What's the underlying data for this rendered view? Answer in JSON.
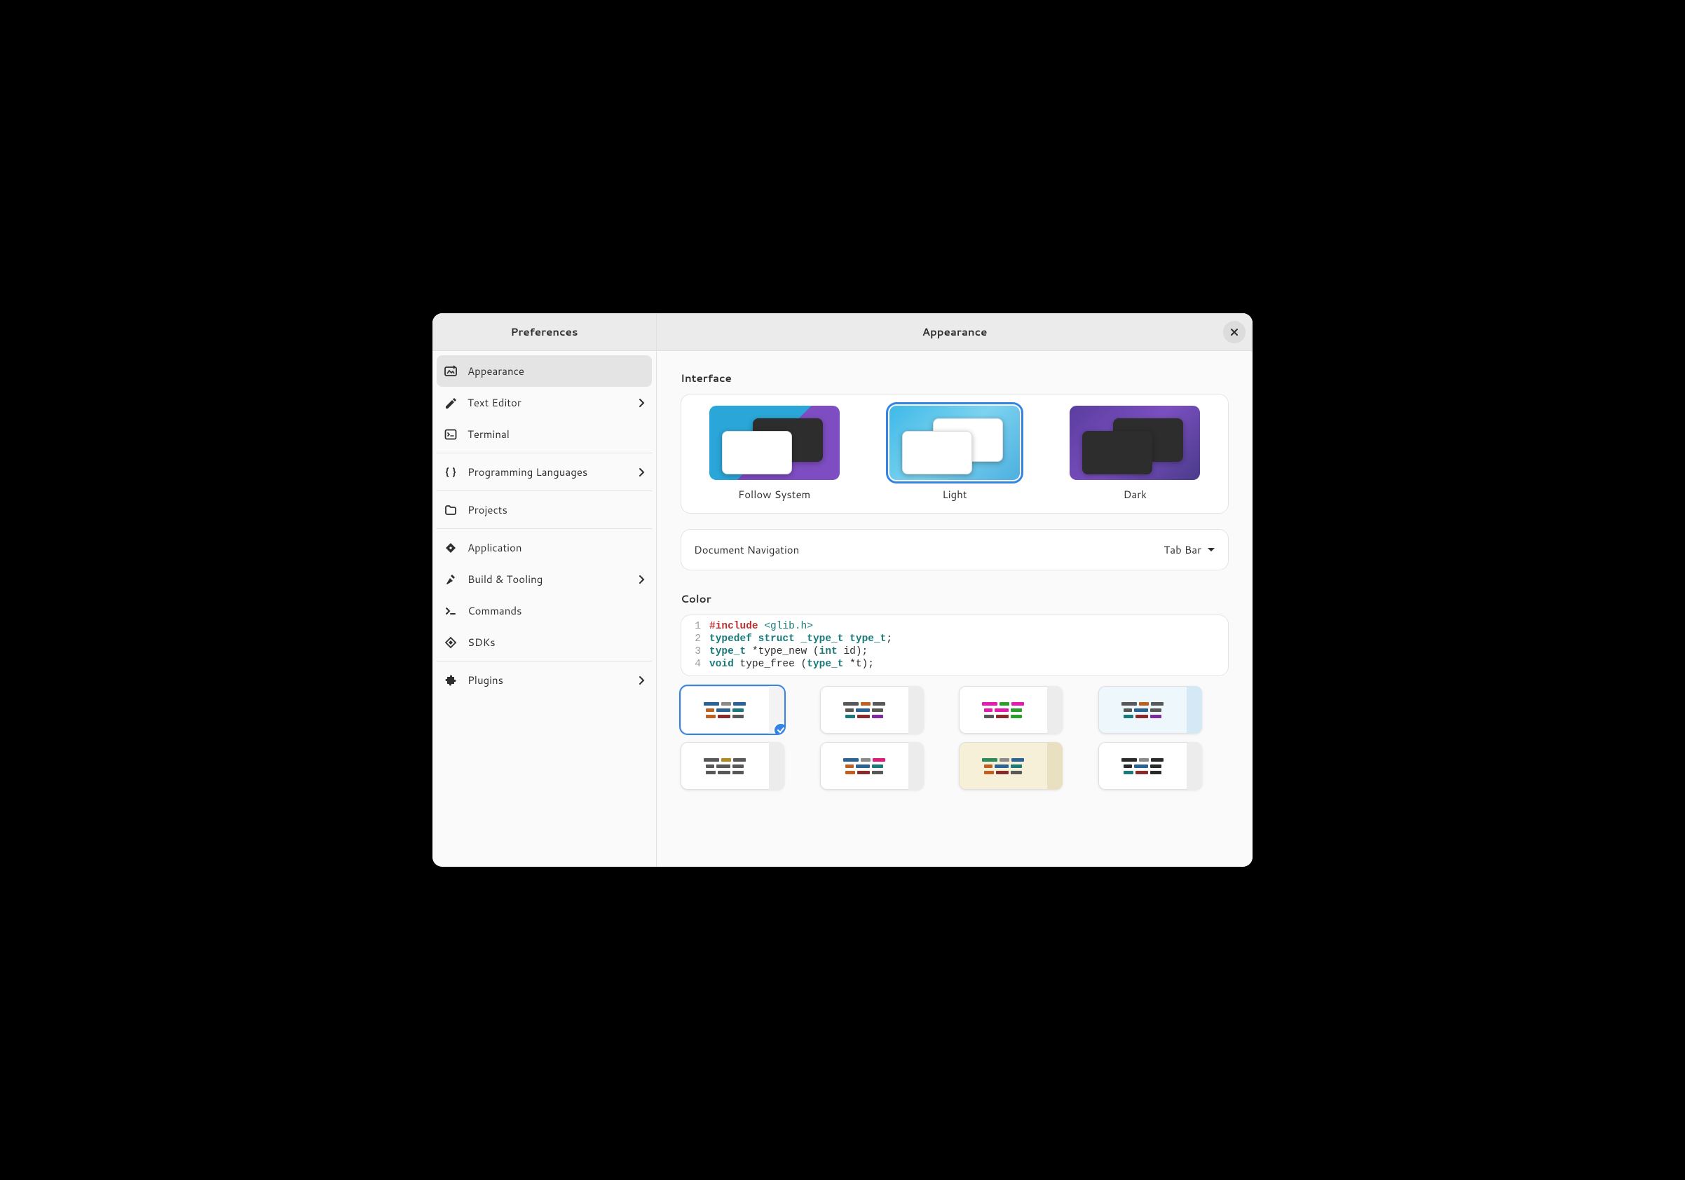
{
  "sidebar": {
    "title": "Preferences",
    "items": [
      {
        "label": "Appearance",
        "icon": "appearance-icon",
        "has_chevron": false,
        "selected": true
      },
      {
        "label": "Text Editor",
        "icon": "pencil-icon",
        "has_chevron": true
      },
      {
        "label": "Terminal",
        "icon": "terminal-icon",
        "has_chevron": false
      },
      {
        "label": "Programming Languages",
        "icon": "braces-icon",
        "has_chevron": true
      },
      {
        "label": "Projects",
        "icon": "folder-icon",
        "has_chevron": false
      },
      {
        "label": "Application",
        "icon": "diamond-icon",
        "has_chevron": false
      },
      {
        "label": "Build & Tooling",
        "icon": "hammer-icon",
        "has_chevron": true
      },
      {
        "label": "Commands",
        "icon": "prompt-icon",
        "has_chevron": false
      },
      {
        "label": "SDKs",
        "icon": "sdk-icon",
        "has_chevron": false
      },
      {
        "label": "Plugins",
        "icon": "puzzle-icon",
        "has_chevron": true
      }
    ],
    "separators_after": [
      2,
      3,
      4,
      8
    ]
  },
  "main": {
    "title": "Appearance",
    "interface": {
      "heading": "Interface",
      "themes": [
        {
          "key": "follow",
          "label": "Follow System",
          "selected": false
        },
        {
          "key": "light",
          "label": "Light",
          "selected": true
        },
        {
          "key": "dark",
          "label": "Dark",
          "selected": false
        }
      ]
    },
    "doc_nav": {
      "label": "Document Navigation",
      "value": "Tab Bar"
    },
    "color": {
      "heading": "Color",
      "code": [
        {
          "n": "1",
          "html": "<span class='inc'>#include</span> <span class='str'>&lt;glib.h&gt;</span>"
        },
        {
          "n": "2",
          "html": "<span class='kw'>typedef</span> <span class='kw'>struct</span> <span class='typ'>_type_t</span> <span class='typ'>type_t</span>;"
        },
        {
          "n": "3",
          "html": "<span class='typ'>type_t</span> *type_new (<span class='kw'>int</span> id);"
        },
        {
          "n": "4",
          "html": "<span class='kw'>void</span> type_free (<span class='typ'>type_t</span> *t);"
        }
      ],
      "schemes": [
        {
          "selected": true,
          "side": "#f3f3f3",
          "bg": "#fff",
          "colors": [
            "#2a6496",
            "#8a8a8a",
            "#2a6496",
            "#c06020",
            "#2a6496",
            "#1a7a7a",
            "#c06020",
            "#8a2a2a",
            "#585858"
          ]
        },
        {
          "selected": false,
          "side": "#ececec",
          "bg": "#fff",
          "colors": [
            "#585858",
            "#c06020",
            "#585858",
            "#585858",
            "#2a6496",
            "#585858",
            "#1a7a7a",
            "#8a2a2a",
            "#7e2a9e"
          ]
        },
        {
          "selected": false,
          "side": "#ececec",
          "bg": "#fff",
          "colors": [
            "#e61ab0",
            "#2aa02a",
            "#e61ab0",
            "#e61ab0",
            "#e61ab0",
            "#2aa02a",
            "#585858",
            "#8a2a2a",
            "#2aa02a"
          ]
        },
        {
          "selected": false,
          "side": "#d4e9f5",
          "bg": "#eef7fb",
          "colors": [
            "#585858",
            "#c06020",
            "#585858",
            "#585858",
            "#2a6496",
            "#585858",
            "#1a7a7a",
            "#8a2a2a",
            "#7e2a9e"
          ]
        },
        {
          "selected": false,
          "side": "#ececec",
          "bg": "#fff",
          "colors": [
            "#585858",
            "#b08a20",
            "#585858",
            "#585858",
            "#585858",
            "#585858",
            "#585858",
            "#585858",
            "#585858"
          ]
        },
        {
          "selected": false,
          "side": "#ececec",
          "bg": "#fff",
          "colors": [
            "#2a6496",
            "#8a8a8a",
            "#e01a7a",
            "#c06020",
            "#2a6496",
            "#1a7a7a",
            "#c06020",
            "#8a2a2a",
            "#585858"
          ]
        },
        {
          "selected": false,
          "side": "#e9e0c2",
          "bg": "#f6f0d8",
          "colors": [
            "#2a8a5a",
            "#8a8a8a",
            "#2a6496",
            "#c06020",
            "#2a6496",
            "#1a7a7a",
            "#c06020",
            "#8a2a2a",
            "#585858"
          ]
        },
        {
          "selected": false,
          "side": "#ececec",
          "bg": "#fff",
          "colors": [
            "#2a2a2a",
            "#8a8a8a",
            "#2a2a2a",
            "#2a2a2a",
            "#2a6496",
            "#2a2a2a",
            "#1a7a7a",
            "#8a2a2a",
            "#2a2a2a"
          ]
        }
      ]
    }
  }
}
